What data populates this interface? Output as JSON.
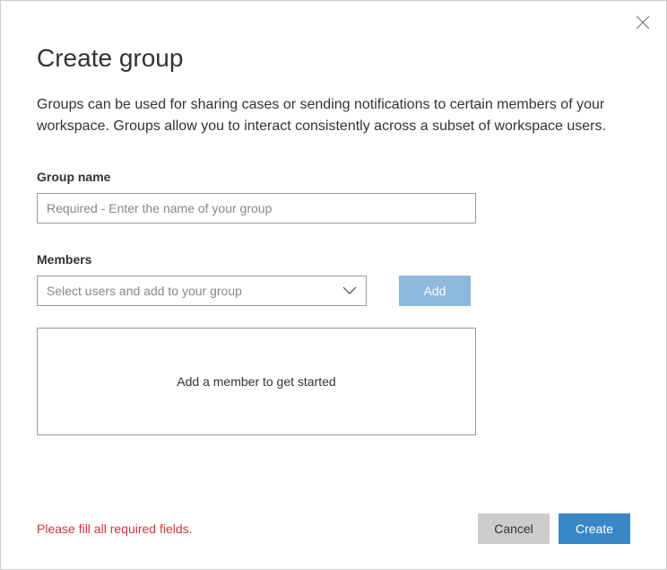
{
  "title": "Create group",
  "description": "Groups can be used for sharing cases or sending notifications to certain members of your workspace. Groups allow you to interact consistently across a subset of workspace users.",
  "groupName": {
    "label": "Group name",
    "placeholder": "Required - Enter the name of your group",
    "value": ""
  },
  "members": {
    "label": "Members",
    "selectPlaceholder": "Select users and add to your group",
    "addLabel": "Add",
    "emptyMessage": "Add a member to get started"
  },
  "error": "Please fill all required fields.",
  "footer": {
    "cancel": "Cancel",
    "create": "Create"
  }
}
